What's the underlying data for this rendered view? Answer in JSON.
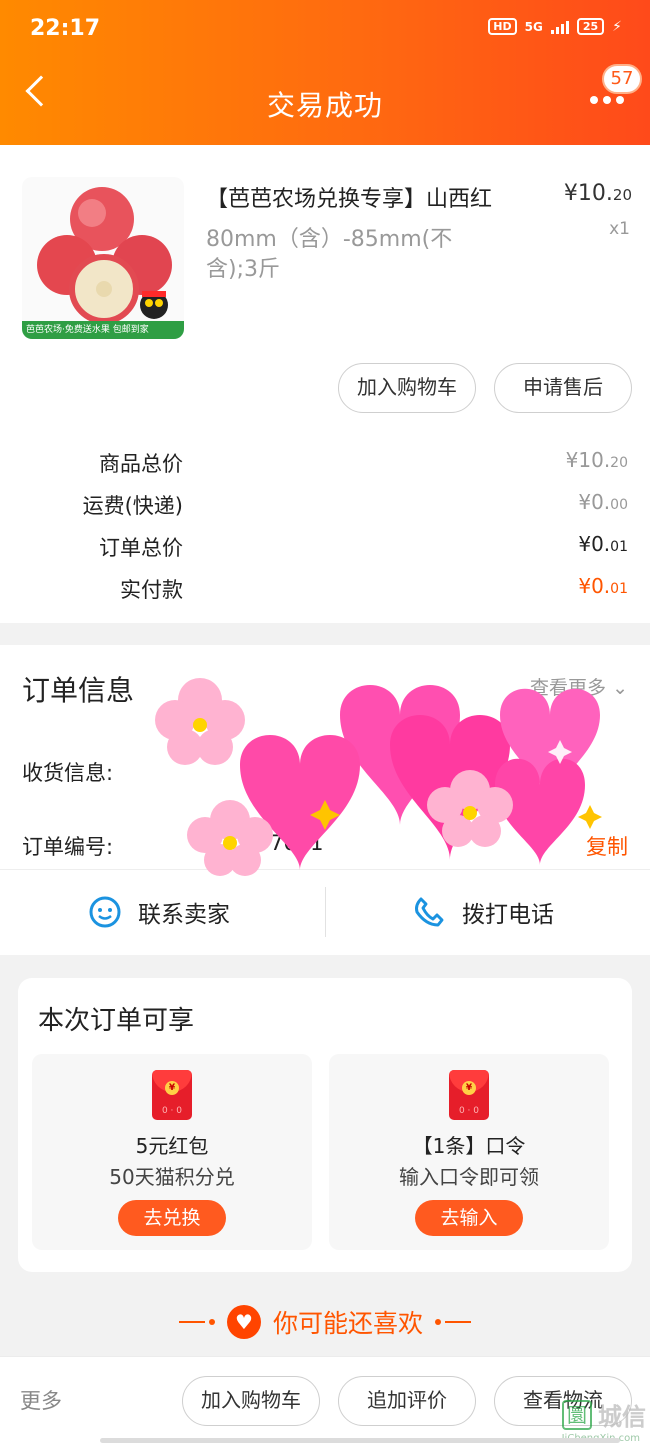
{
  "status_bar": {
    "time": "22:17",
    "hd": "HD",
    "network": "5G",
    "battery": "25"
  },
  "header": {
    "title": "交易成功",
    "message_count": "57"
  },
  "product": {
    "title": "【芭芭农场兑换专享】山西红",
    "spec": "80mm（含）-85mm(不含);3斤",
    "price_main": "¥10.",
    "price_cents": "20",
    "quantity": "x1",
    "image_footer": "芭芭农场·免费送水果 包邮到家",
    "add_cart_label": "加入购物车",
    "after_sale_label": "申请售后"
  },
  "pricing": {
    "rows": [
      {
        "label": "商品总价",
        "main": "¥10.",
        "cents": "20"
      },
      {
        "label": "运费(快递)",
        "main": "¥0.",
        "cents": "00"
      },
      {
        "label": "订单总价",
        "main": "¥0.",
        "cents": "01"
      },
      {
        "label": "实付款",
        "main": "¥0.",
        "cents": "01"
      }
    ]
  },
  "order_info": {
    "title": "订单信息",
    "view_more": "查看更多",
    "shipping_label": "收货信息:",
    "order_no_label": "订单编号:",
    "order_no_fragment": "7661",
    "copy_label": "复制",
    "contact_seller": "联系卖家",
    "call_phone": "拨打电话"
  },
  "benefits": {
    "title": "本次订单可享",
    "items": [
      {
        "name": "5元红包",
        "desc": "50天猫积分兑",
        "button": "去兑换",
        "icon_label": "0 · 0"
      },
      {
        "name": "【1条】口令",
        "desc": "输入口令即可领",
        "button": "去输入",
        "icon_label": "0 · 0"
      }
    ]
  },
  "recommend": {
    "title": "你可能还喜欢"
  },
  "bottom_bar": {
    "more": "更多",
    "add_cart": "加入购物车",
    "add_review": "追加评价",
    "view_logistics": "查看物流"
  },
  "watermark": {
    "logo": "圜",
    "text": "城信",
    "url": "JiChengXin.com"
  },
  "colors": {
    "header_start": "#ff8a00",
    "header_end": "#ff4a1a",
    "accent": "#ff5500",
    "icon_blue": "#1b93e0",
    "red_packet": "#e61e2a"
  }
}
